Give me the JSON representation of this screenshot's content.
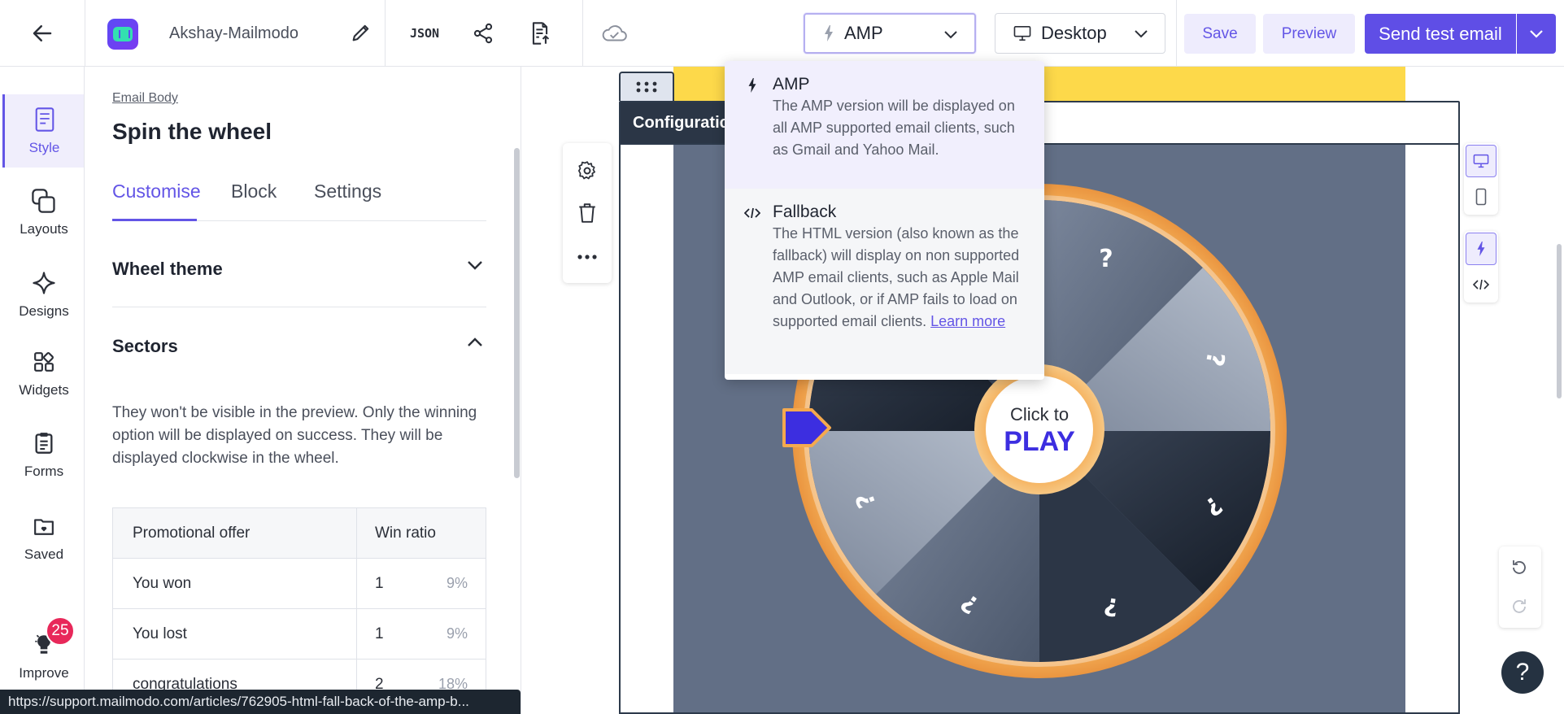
{
  "topbar": {
    "project_name": "Akshay-Mailmodo",
    "json_label": "JSON",
    "version_select": "AMP",
    "device_select": "Desktop",
    "save_label": "Save",
    "preview_label": "Preview",
    "send_label": "Send test email",
    "icons": [
      "back-arrow-icon",
      "logo",
      "pencil-icon",
      "share-icon",
      "export-icon",
      "cloud-saved-icon",
      "bolt-icon",
      "monitor-icon",
      "chevron-down-icon"
    ]
  },
  "rail": {
    "items": [
      {
        "label": "Style",
        "icon": "style-icon",
        "active": true
      },
      {
        "label": "Layouts",
        "icon": "layouts-icon"
      },
      {
        "label": "Designs",
        "icon": "sparkle-icon"
      },
      {
        "label": "Widgets",
        "icon": "widgets-icon"
      },
      {
        "label": "Forms",
        "icon": "forms-icon"
      },
      {
        "label": "Saved",
        "icon": "saved-folder-icon"
      },
      {
        "label": "Improve",
        "icon": "lightbulb-icon"
      }
    ],
    "improve_badge": "25"
  },
  "panel": {
    "breadcrumb": "Email Body",
    "title": "Spin the wheel",
    "tabs": [
      "Customise",
      "Block",
      "Settings"
    ],
    "active_tab": "Customise",
    "sections": {
      "wheel_theme": "Wheel theme",
      "sectors": "Sectors"
    },
    "sectors_note": "They won't be visible in the preview. Only the winning option will be displayed on success. They will be displayed clockwise in the wheel.",
    "table": {
      "headers": [
        "Promotional offer",
        "Win ratio"
      ],
      "rows": [
        {
          "offer": "You won",
          "ratio": "1",
          "pct": "9%"
        },
        {
          "offer": "You lost",
          "ratio": "1",
          "pct": "9%"
        },
        {
          "offer": "congratulations",
          "ratio": "2",
          "pct": "18%"
        }
      ]
    }
  },
  "status_url": "https://support.mailmodo.com/articles/762905-html-fall-back-of-the-amp-b...",
  "canvas": {
    "config_label": "Configuratic",
    "wheel": {
      "center_top": "Click to",
      "center_bottom": "PLAY",
      "sector_glyphs": [
        "?",
        "?",
        "?",
        "?",
        "?",
        "?"
      ]
    },
    "colors": {
      "yellow_strip": "#fdd94a",
      "wheel_bg": "#626f86",
      "ring": "#f2a84e",
      "pointer": "#3c2ee0",
      "accent": "#5f4ee6"
    }
  },
  "dropdown": {
    "options": [
      {
        "title": "AMP",
        "icon": "bolt-icon",
        "desc": "The AMP version will be displayed on all AMP supported email clients, such as Gmail and Yahoo Mail."
      },
      {
        "title": "Fallback",
        "icon": "code-icon",
        "desc": "The HTML version (also known as the fallback) will display on non supported AMP email clients, such as Apple Mail and Outlook, or if AMP fails to load on supported email clients.",
        "link": "Learn more"
      }
    ]
  }
}
